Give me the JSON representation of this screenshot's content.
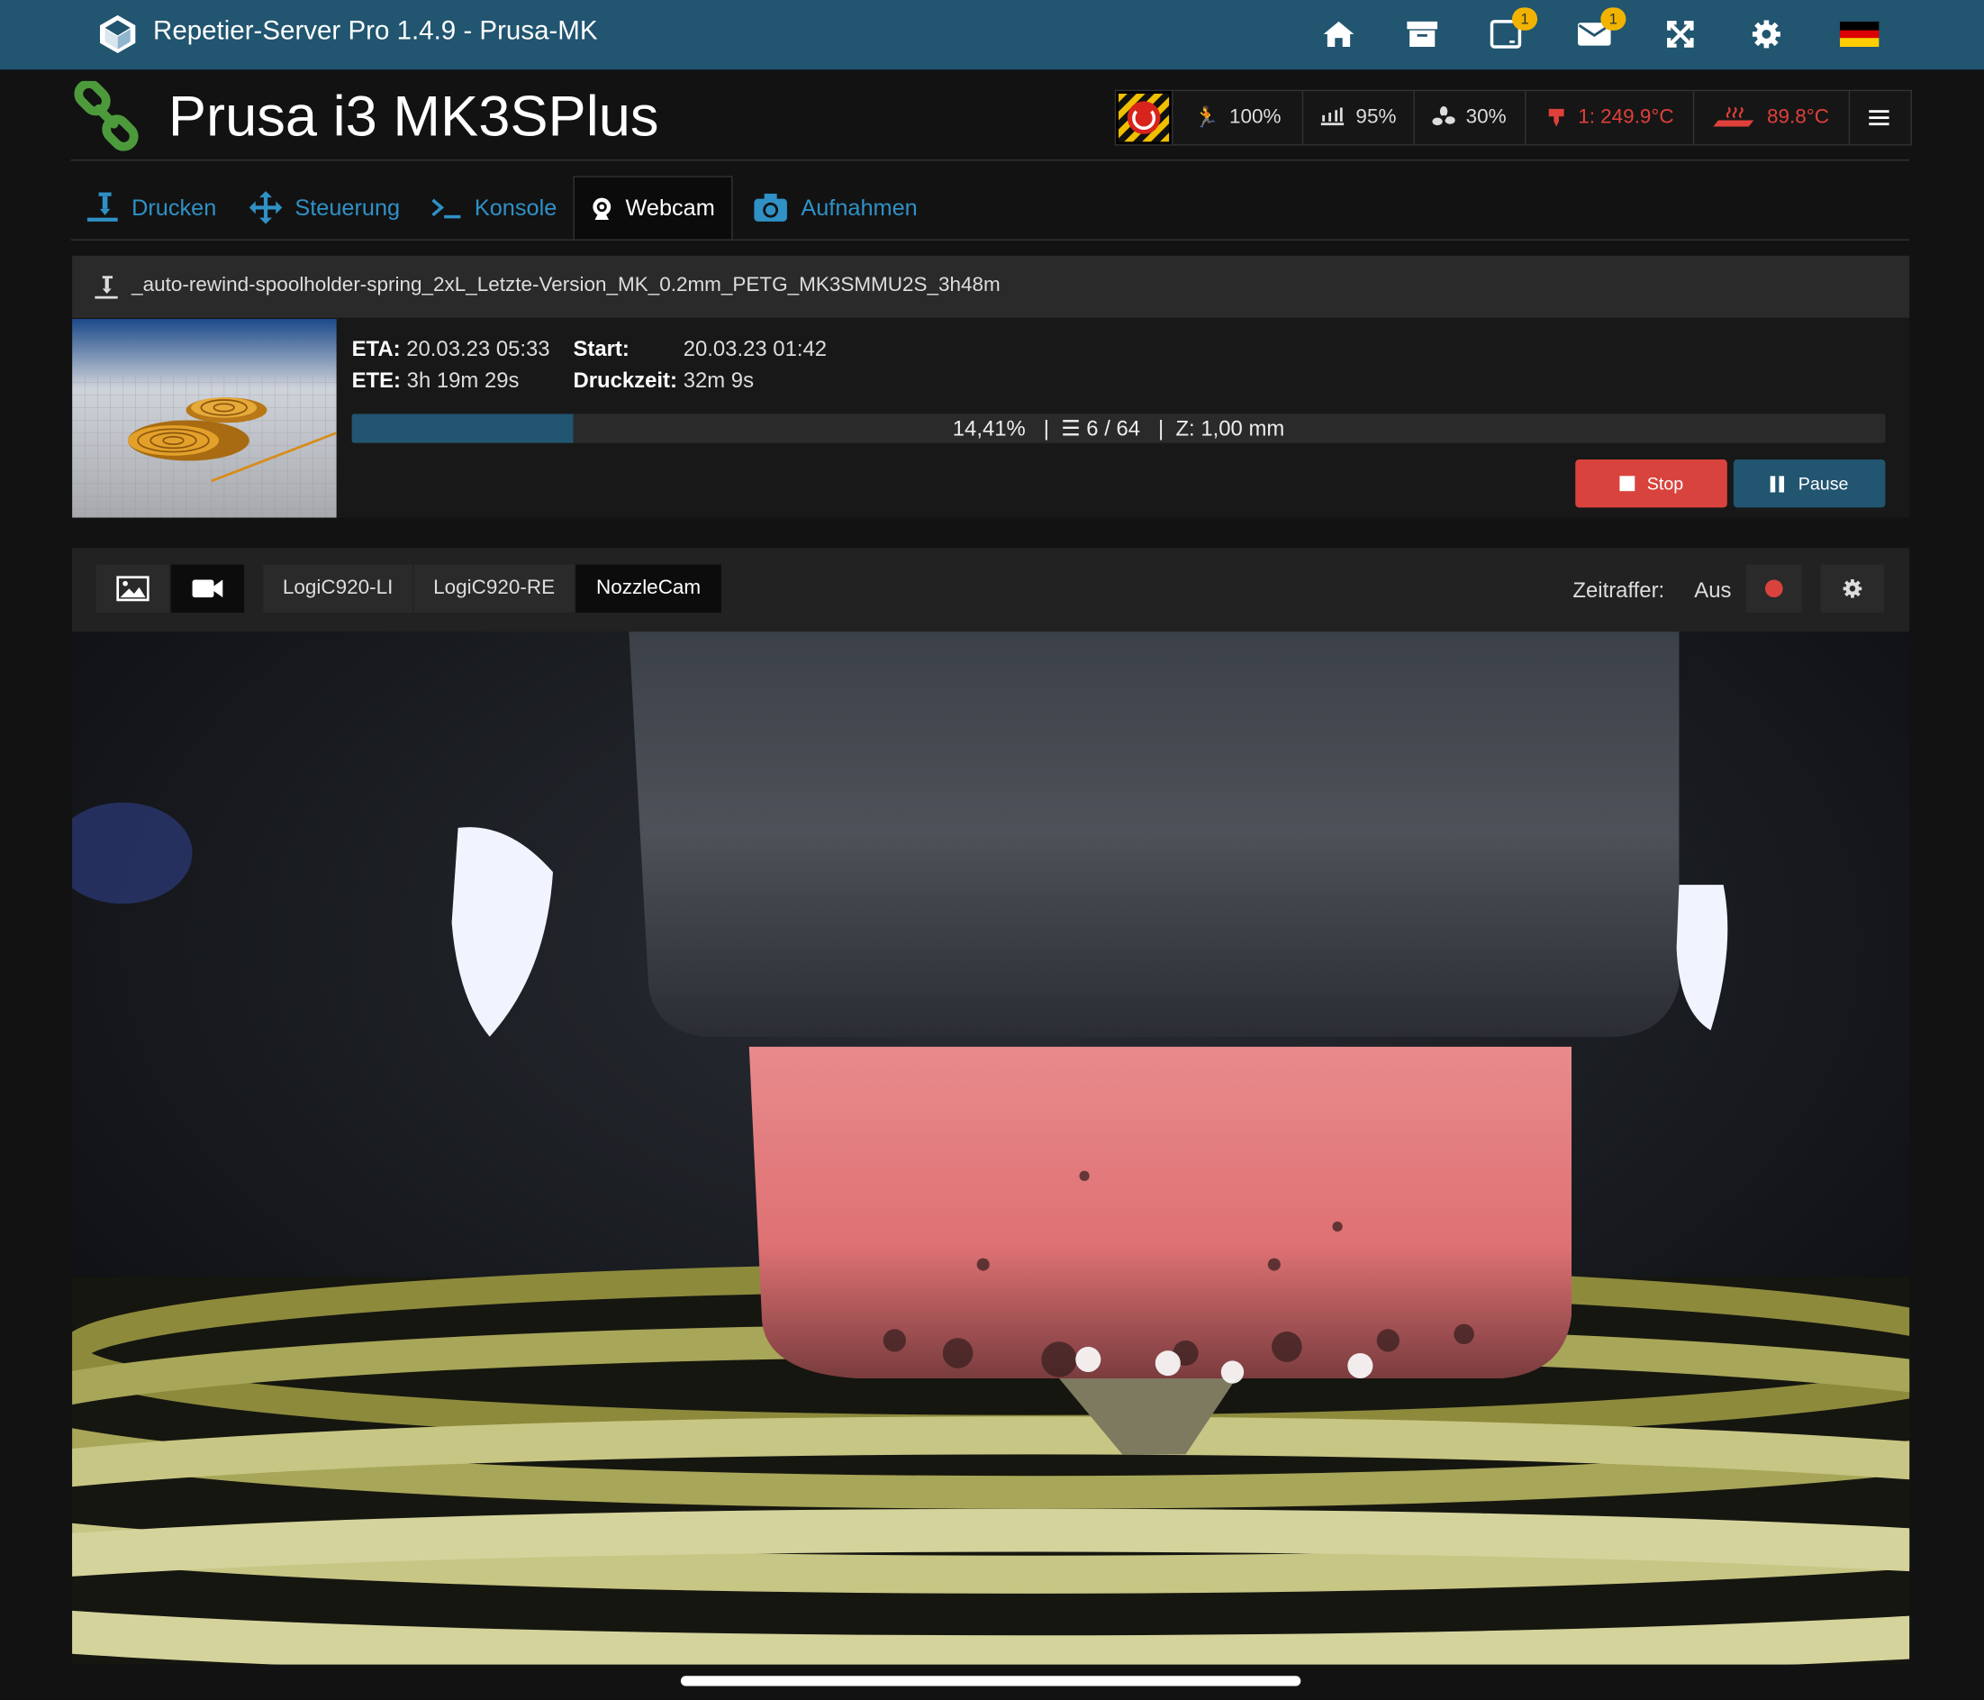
{
  "app": {
    "title": "Repetier-Server Pro 1.4.9 - Prusa-MK"
  },
  "topbar": {
    "icons": [
      "home-icon",
      "archive-icon",
      "tablet-icon",
      "envelope-icon",
      "expand-icon",
      "gear-icon",
      "flag-germany-icon"
    ],
    "tablet_badge": "1",
    "mail_badge": "1"
  },
  "printer": {
    "name": "Prusa i3 MK3SPlus"
  },
  "status": {
    "speed": "100%",
    "flow": "95%",
    "fan": "30%",
    "extruder_temp": "1: 249.9°C",
    "bed_temp": "89.8°C"
  },
  "tabs": [
    {
      "label": "Drucken",
      "icon": "print-icon"
    },
    {
      "label": "Steuerung",
      "icon": "move-icon"
    },
    {
      "label": "Konsole",
      "icon": "terminal-icon"
    },
    {
      "label": "Webcam",
      "icon": "webcam-icon"
    },
    {
      "label": "Aufnahmen",
      "icon": "camera-icon"
    }
  ],
  "job": {
    "filename": "_auto-rewind-spoolholder-spring_2xL_Letzte-Version_MK_0.2mm_PETG_MK3SMMU2S_3h48m",
    "eta_label": "ETA:",
    "eta": "20.03.23 05:33",
    "ete_label": "ETE:",
    "ete": "3h 19m 29s",
    "start_label": "Start:",
    "start": "20.03.23 01:42",
    "printtime_label": "Druckzeit:",
    "printtime": "32m 9s",
    "progress": 0.1441,
    "progress_text": "14,41%",
    "layers": "6 / 64",
    "z": "Z: 1,00 mm",
    "stop_label": "Stop",
    "pause_label": "Pause"
  },
  "webcam": {
    "cameras": [
      "LogiC920-LI",
      "LogiC920-RE",
      "NozzleCam"
    ],
    "active_camera": "NozzleCam",
    "timelapse_label": "Zeitraffer:",
    "timelapse_value": "Aus"
  },
  "colors": {
    "topbar": "#215570",
    "accent": "#2f91c6",
    "danger": "#d9433d",
    "badge": "#f0b400"
  }
}
